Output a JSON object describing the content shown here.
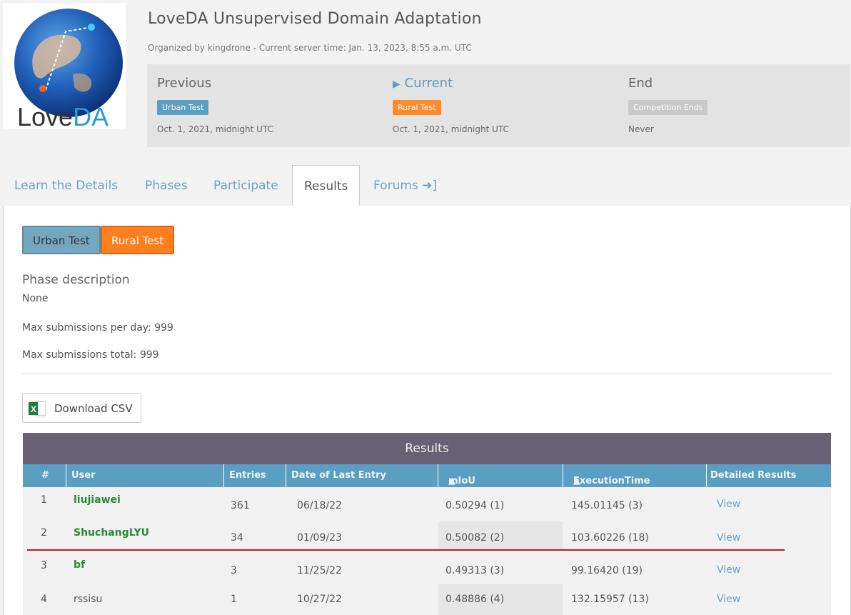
{
  "logo": {
    "text_love": "Love",
    "text_da": "DA"
  },
  "header": {
    "title": "LoveDA Unsupervised Domain Adaptation",
    "subtitle": "Organized by kingdrone - Current server time: Jan. 13, 2023, 8:55 a.m. UTC"
  },
  "phases": {
    "previous": {
      "heading": "Previous",
      "badge": "Urban Test",
      "date": "Oct. 1, 2021, midnight UTC"
    },
    "current": {
      "heading": "Current",
      "badge": "Rural Test",
      "date": "Oct. 1, 2021, midnight UTC"
    },
    "end": {
      "heading": "End",
      "badge": "Competition Ends",
      "date": "Never"
    }
  },
  "tabs": [
    "Learn the Details",
    "Phases",
    "Participate",
    "Results",
    "Forums"
  ],
  "phase_buttons": {
    "urban": "Urban Test",
    "rural": "Rural Test"
  },
  "description": {
    "title": "Phase description",
    "text": "None",
    "max_per_day": "Max submissions per day: 999",
    "max_total": "Max submissions total: 999"
  },
  "download_csv": "Download CSV",
  "results": {
    "title": "Results",
    "columns": [
      "#",
      "User",
      "Entries",
      "Date of Last Entry",
      "mIoU",
      "ExecutionTime",
      "Detailed Results"
    ],
    "rows": [
      {
        "rank": "1",
        "user": "liujiawei",
        "entries": "361",
        "date": "06/18/22",
        "miou": "0.50294 (1)",
        "exec": "145.01145 (3)",
        "detail": "View"
      },
      {
        "rank": "2",
        "user": "ShuchangLYU",
        "entries": "34",
        "date": "01/09/23",
        "miou": "0.50082 (2)",
        "exec": "103.60226 (18)",
        "detail": "View"
      },
      {
        "rank": "3",
        "user": "bf",
        "entries": "3",
        "date": "11/25/22",
        "miou": "0.49313 (3)",
        "exec": "99.16420 (19)",
        "detail": "View"
      },
      {
        "rank": "4",
        "user": "rssisu",
        "entries": "1",
        "date": "10/27/22",
        "miou": "0.48886 (4)",
        "exec": "132.15957 (13)",
        "detail": "View"
      }
    ]
  },
  "colors": {
    "accent": "#5a9ec1",
    "rural_orange": "#ff7f1e",
    "results_header": "#686074",
    "user_green": "#2a8a35",
    "annotation_red": "#cc1a1a"
  },
  "icons": {
    "current_marker": "play-triangle-icon",
    "forums": "sign-in-icon",
    "sort": "sort-up-icon",
    "excel": "excel-icon"
  }
}
